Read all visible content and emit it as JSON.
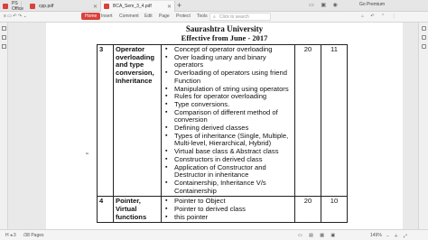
{
  "tabs": [
    {
      "label": "PS Office",
      "icon_color": "#d9413b"
    },
    {
      "label": "cpp.pdf",
      "icon_color": "#d9413b"
    },
    {
      "label": "BCA_Sem_3_4.pdf",
      "icon_color": "#d9413b"
    }
  ],
  "tab_icons": "▭ ▣ ◉",
  "premium_label": "Go Premium",
  "menu": {
    "items": [
      "Home",
      "Insert",
      "Comment",
      "Edit",
      "Page",
      "Protect",
      "Tools"
    ],
    "search_placeholder": "Click to search"
  },
  "toolbar_icons": "⌂ ↶ ⌃ ⋮",
  "document": {
    "university": "Saurashtra University",
    "effective": "Effective from June - 2017",
    "units": [
      {
        "num": "3",
        "title": "Operator overloading and type conversion, Inheritance",
        "topics": [
          "Concept of operator overloading",
          "Over loading unary and binary operators",
          "Overloading of operators using friend Function",
          "Manipulation of string using operators",
          "Rules for operator overloading",
          "Type conversions.",
          "Comparison of different method of conversion",
          "Defining derived classes",
          "Types of inheritance (Single, Multiple, Multi-level, Hierarchical, Hybrid)",
          "Virtual base class & Abstract class",
          "Constructors in derived class",
          "Application of Constructor and Destructor in inheritance",
          "Containership, Inheritance V/s Containership"
        ],
        "hours": "20",
        "marks": "11"
      },
      {
        "num": "4",
        "title": "Pointer, Virtual functions",
        "topics": [
          "Pointer to Object",
          "Pointer to derived class",
          "this pointer"
        ],
        "hours": "20",
        "marks": "10"
      }
    ]
  },
  "status": {
    "page_nav": "H ◂ 3",
    "page_count": "/38 Pages",
    "zoom": "149%"
  }
}
